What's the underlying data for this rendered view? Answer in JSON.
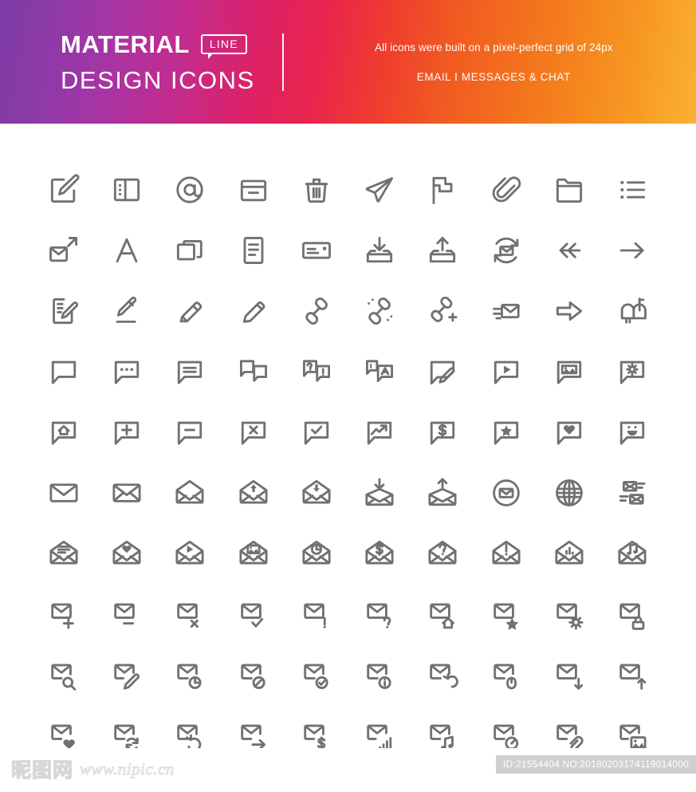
{
  "header": {
    "brand_primary": "MATERIAL",
    "brand_badge": "LINE",
    "brand_secondary": "DESIGN ICONS",
    "tagline": "All icons were built on a pixel-perfect grid of 24px",
    "category": "EMAIL  I  MESSAGES & CHAT",
    "gradient_start": "#7d3ca5",
    "gradient_mid": "#e9254c",
    "gradient_end": "#f9b233"
  },
  "grid": {
    "columns": 10,
    "rows": 10,
    "icon_color": "#6f7271",
    "icons": [
      "compose-square-icon",
      "split-layout-icon",
      "at-sign-icon",
      "archive-box-icon",
      "trash-icon",
      "paper-plane-icon",
      "flag-icon",
      "paperclip-icon",
      "folder-icon",
      "list-bullets-icon",
      "mail-external-link-icon",
      "text-format-icon",
      "windows-copy-icon",
      "document-lines-icon",
      "id-card-icon",
      "inbox-download-icon",
      "outbox-upload-icon",
      "mail-sync-icon",
      "reply-all-icon",
      "forward-arrow-icon",
      "edit-document-icon",
      "pencil-underline-icon",
      "pen-icon",
      "pencil-icon",
      "link-icon",
      "link-broken-icon",
      "link-add-icon",
      "mail-incoming-icon",
      "arrow-right-bold-icon",
      "mailbox-icon",
      "chat-empty-icon",
      "chat-typing-icon",
      "chat-lines-icon",
      "chat-double-icon",
      "chat-question-alert-icon",
      "chat-translate-icon",
      "chat-edit-icon",
      "chat-video-icon",
      "chat-image-icon",
      "chat-settings-icon",
      "chat-home-icon",
      "chat-plus-icon",
      "chat-minus-icon",
      "chat-close-icon",
      "chat-check-icon",
      "chat-trend-icon",
      "chat-dollar-icon",
      "chat-star-icon",
      "chat-heart-icon",
      "chat-smile-icon",
      "envelope-closed-icon",
      "envelope-sealed-icon",
      "envelope-open-icon",
      "envelope-open-up-icon",
      "envelope-open-down-icon",
      "envelope-receive-icon",
      "envelope-send-icon",
      "envelope-circle-icon",
      "globe-icon",
      "multiple-envelopes-icon",
      "envelope-text-icon",
      "envelope-heart-icon",
      "envelope-video-icon",
      "envelope-image-icon",
      "envelope-clock-icon",
      "envelope-dollar-icon",
      "envelope-question-icon",
      "envelope-alert-icon",
      "envelope-chart-icon",
      "envelope-music-icon",
      "mail-add-icon",
      "mail-remove-icon",
      "mail-delete-icon",
      "mail-check-icon",
      "mail-alert-icon",
      "mail-question-icon",
      "mail-home-icon",
      "mail-star-icon",
      "mail-settings-icon",
      "mail-lock-icon",
      "mail-search-icon",
      "mail-edit-icon",
      "mail-clock-icon",
      "mail-block-icon",
      "mail-verified-icon",
      "mail-info-icon",
      "mail-undo-icon",
      "mail-mouse-icon",
      "mail-download-icon",
      "mail-upload-icon",
      "mail-favorite-icon",
      "mail-sync-round-icon",
      "mail-restore-icon",
      "mail-forward-icon",
      "mail-payment-icon",
      "mail-signal-icon",
      "mail-music-icon",
      "mail-timer-icon",
      "mail-attachment-icon",
      "mail-photo-icon"
    ]
  },
  "footer": {
    "watermark_cjk": "昵图网",
    "watermark_url": "www.nipic.cn",
    "id_badge": "ID:21554404 NO:20180203174119014000",
    "badge_bg": "#cfcfcf"
  }
}
